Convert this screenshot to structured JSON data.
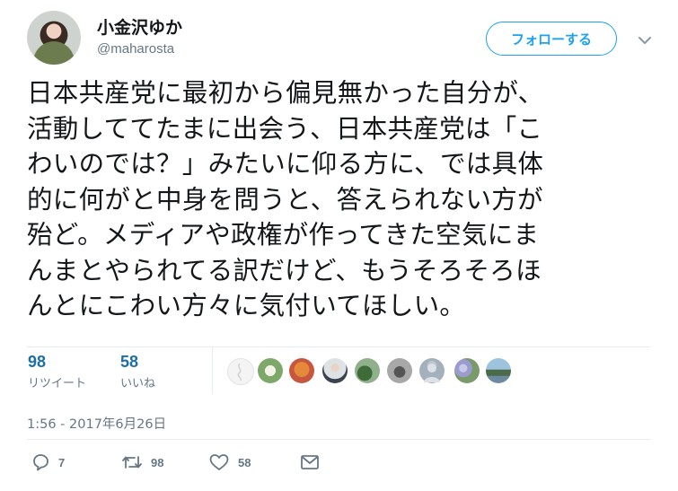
{
  "user": {
    "display_name": "小金沢ゆか",
    "handle": "@maharosta"
  },
  "follow_button_label": "フォローする",
  "tweet_text": "日本共産党に最初から偏見無かった自分が、\n活動しててたまに出会う、日本共産党は「こ\nわいのでは？」みたいに仰る方に、では具体\n的に何がと中身を問うと、答えられない方が\n殆ど。メディアや政権が作ってきた空気にま\nんまとやられてる訳だけど、もうそろそろほ\nんとにこわい方々に気付いてほしい。",
  "stats": {
    "retweets": {
      "count": "98",
      "label": "リツイート"
    },
    "likes": {
      "count": "58",
      "label": "いいね"
    }
  },
  "timestamp": "1:56 - 2017年6月26日",
  "actions": {
    "reply_count": "7",
    "retweet_count": "98",
    "like_count": "58"
  },
  "colors": {
    "accent": "#1da1f2",
    "stat_number": "#1d6fa5",
    "muted_text": "#657786",
    "divider": "#e6ecf0"
  },
  "icons": [
    "chevron-down-icon",
    "reply-icon",
    "retweet-icon",
    "heart-icon",
    "message-icon"
  ]
}
